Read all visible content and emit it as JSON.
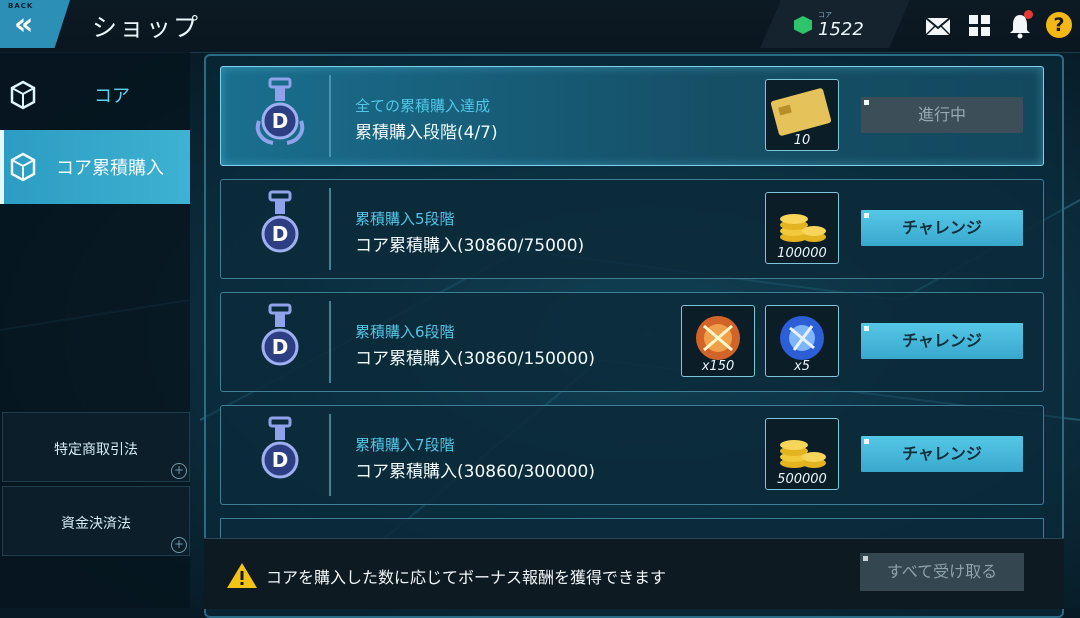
{
  "header": {
    "back_tag": "BACK",
    "title": "ショップ",
    "currency_label": "コア",
    "currency_value": "1522"
  },
  "sidebar": {
    "items": [
      {
        "label": "コア"
      },
      {
        "label": "コア累積購入"
      }
    ],
    "links": [
      {
        "label": "特定商取引法"
      },
      {
        "label": "資金決済法"
      }
    ]
  },
  "cards": [
    {
      "title": "全ての累積購入達成",
      "subtitle": "累積購入段階(4/7)",
      "rewards": [
        {
          "icon": "gold-card-icon",
          "qty": "10"
        }
      ],
      "button": "進行中",
      "button_enabled": false
    },
    {
      "title": "累積購入5段階",
      "subtitle": "コア累積購入(30860/75000)",
      "rewards": [
        {
          "icon": "gold-coins-icon",
          "qty": "100000"
        }
      ],
      "button": "チャレンジ",
      "button_enabled": true
    },
    {
      "title": "累積購入6段階",
      "subtitle": "コア累積購入(30860/150000)",
      "rewards": [
        {
          "icon": "orange-orb-icon",
          "qty": "x150"
        },
        {
          "icon": "blue-orb-icon",
          "qty": "x5"
        }
      ],
      "button": "チャレンジ",
      "button_enabled": true
    },
    {
      "title": "累積購入7段階",
      "subtitle": "コア累積購入(30860/300000)",
      "rewards": [
        {
          "icon": "gold-coins-icon",
          "qty": "500000"
        }
      ],
      "button": "チャレンジ",
      "button_enabled": true
    }
  ],
  "footer": {
    "notice": "コアを購入した数に応じてボーナス報酬を獲得できます",
    "claim_all": "すべて受け取る"
  },
  "colors": {
    "accent": "#3eb2d2",
    "button": "#55c7e6",
    "title_cyan": "#52c6e8",
    "currency_gem": "#2ec56a",
    "help": "#f3b716",
    "notification": "#e53935"
  }
}
